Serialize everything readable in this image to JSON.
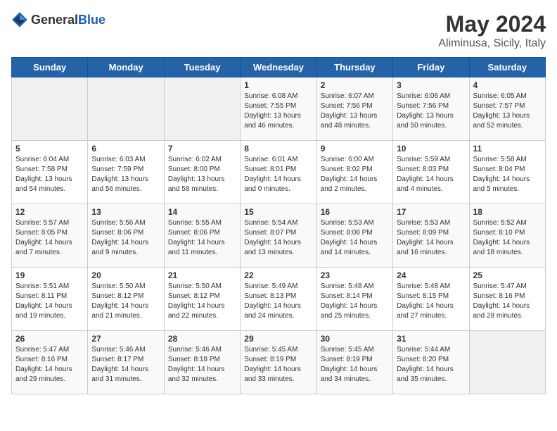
{
  "logo": {
    "text_general": "General",
    "text_blue": "Blue"
  },
  "title": "May 2024",
  "subtitle": "Aliminusa, Sicily, Italy",
  "weekdays": [
    "Sunday",
    "Monday",
    "Tuesday",
    "Wednesday",
    "Thursday",
    "Friday",
    "Saturday"
  ],
  "rows": [
    [
      {
        "day": "",
        "sunrise": "",
        "sunset": "",
        "daylight": "",
        "empty": true
      },
      {
        "day": "",
        "sunrise": "",
        "sunset": "",
        "daylight": "",
        "empty": true
      },
      {
        "day": "",
        "sunrise": "",
        "sunset": "",
        "daylight": "",
        "empty": true
      },
      {
        "day": "1",
        "sunrise": "Sunrise: 6:08 AM",
        "sunset": "Sunset: 7:55 PM",
        "daylight": "Daylight: 13 hours and 46 minutes."
      },
      {
        "day": "2",
        "sunrise": "Sunrise: 6:07 AM",
        "sunset": "Sunset: 7:56 PM",
        "daylight": "Daylight: 13 hours and 48 minutes."
      },
      {
        "day": "3",
        "sunrise": "Sunrise: 6:06 AM",
        "sunset": "Sunset: 7:56 PM",
        "daylight": "Daylight: 13 hours and 50 minutes."
      },
      {
        "day": "4",
        "sunrise": "Sunrise: 6:05 AM",
        "sunset": "Sunset: 7:57 PM",
        "daylight": "Daylight: 13 hours and 52 minutes."
      }
    ],
    [
      {
        "day": "5",
        "sunrise": "Sunrise: 6:04 AM",
        "sunset": "Sunset: 7:58 PM",
        "daylight": "Daylight: 13 hours and 54 minutes."
      },
      {
        "day": "6",
        "sunrise": "Sunrise: 6:03 AM",
        "sunset": "Sunset: 7:59 PM",
        "daylight": "Daylight: 13 hours and 56 minutes."
      },
      {
        "day": "7",
        "sunrise": "Sunrise: 6:02 AM",
        "sunset": "Sunset: 8:00 PM",
        "daylight": "Daylight: 13 hours and 58 minutes."
      },
      {
        "day": "8",
        "sunrise": "Sunrise: 6:01 AM",
        "sunset": "Sunset: 8:01 PM",
        "daylight": "Daylight: 14 hours and 0 minutes."
      },
      {
        "day": "9",
        "sunrise": "Sunrise: 6:00 AM",
        "sunset": "Sunset: 8:02 PM",
        "daylight": "Daylight: 14 hours and 2 minutes."
      },
      {
        "day": "10",
        "sunrise": "Sunrise: 5:59 AM",
        "sunset": "Sunset: 8:03 PM",
        "daylight": "Daylight: 14 hours and 4 minutes."
      },
      {
        "day": "11",
        "sunrise": "Sunrise: 5:58 AM",
        "sunset": "Sunset: 8:04 PM",
        "daylight": "Daylight: 14 hours and 5 minutes."
      }
    ],
    [
      {
        "day": "12",
        "sunrise": "Sunrise: 5:57 AM",
        "sunset": "Sunset: 8:05 PM",
        "daylight": "Daylight: 14 hours and 7 minutes."
      },
      {
        "day": "13",
        "sunrise": "Sunrise: 5:56 AM",
        "sunset": "Sunset: 8:06 PM",
        "daylight": "Daylight: 14 hours and 9 minutes."
      },
      {
        "day": "14",
        "sunrise": "Sunrise: 5:55 AM",
        "sunset": "Sunset: 8:06 PM",
        "daylight": "Daylight: 14 hours and 11 minutes."
      },
      {
        "day": "15",
        "sunrise": "Sunrise: 5:54 AM",
        "sunset": "Sunset: 8:07 PM",
        "daylight": "Daylight: 14 hours and 13 minutes."
      },
      {
        "day": "16",
        "sunrise": "Sunrise: 5:53 AM",
        "sunset": "Sunset: 8:08 PM",
        "daylight": "Daylight: 14 hours and 14 minutes."
      },
      {
        "day": "17",
        "sunrise": "Sunrise: 5:53 AM",
        "sunset": "Sunset: 8:09 PM",
        "daylight": "Daylight: 14 hours and 16 minutes."
      },
      {
        "day": "18",
        "sunrise": "Sunrise: 5:52 AM",
        "sunset": "Sunset: 8:10 PM",
        "daylight": "Daylight: 14 hours and 18 minutes."
      }
    ],
    [
      {
        "day": "19",
        "sunrise": "Sunrise: 5:51 AM",
        "sunset": "Sunset: 8:11 PM",
        "daylight": "Daylight: 14 hours and 19 minutes."
      },
      {
        "day": "20",
        "sunrise": "Sunrise: 5:50 AM",
        "sunset": "Sunset: 8:12 PM",
        "daylight": "Daylight: 14 hours and 21 minutes."
      },
      {
        "day": "21",
        "sunrise": "Sunrise: 5:50 AM",
        "sunset": "Sunset: 8:12 PM",
        "daylight": "Daylight: 14 hours and 22 minutes."
      },
      {
        "day": "22",
        "sunrise": "Sunrise: 5:49 AM",
        "sunset": "Sunset: 8:13 PM",
        "daylight": "Daylight: 14 hours and 24 minutes."
      },
      {
        "day": "23",
        "sunrise": "Sunrise: 5:48 AM",
        "sunset": "Sunset: 8:14 PM",
        "daylight": "Daylight: 14 hours and 25 minutes."
      },
      {
        "day": "24",
        "sunrise": "Sunrise: 5:48 AM",
        "sunset": "Sunset: 8:15 PM",
        "daylight": "Daylight: 14 hours and 27 minutes."
      },
      {
        "day": "25",
        "sunrise": "Sunrise: 5:47 AM",
        "sunset": "Sunset: 8:16 PM",
        "daylight": "Daylight: 14 hours and 28 minutes."
      }
    ],
    [
      {
        "day": "26",
        "sunrise": "Sunrise: 5:47 AM",
        "sunset": "Sunset: 8:16 PM",
        "daylight": "Daylight: 14 hours and 29 minutes."
      },
      {
        "day": "27",
        "sunrise": "Sunrise: 5:46 AM",
        "sunset": "Sunset: 8:17 PM",
        "daylight": "Daylight: 14 hours and 31 minutes."
      },
      {
        "day": "28",
        "sunrise": "Sunrise: 5:46 AM",
        "sunset": "Sunset: 8:18 PM",
        "daylight": "Daylight: 14 hours and 32 minutes."
      },
      {
        "day": "29",
        "sunrise": "Sunrise: 5:45 AM",
        "sunset": "Sunset: 8:19 PM",
        "daylight": "Daylight: 14 hours and 33 minutes."
      },
      {
        "day": "30",
        "sunrise": "Sunrise: 5:45 AM",
        "sunset": "Sunset: 8:19 PM",
        "daylight": "Daylight: 14 hours and 34 minutes."
      },
      {
        "day": "31",
        "sunrise": "Sunrise: 5:44 AM",
        "sunset": "Sunset: 8:20 PM",
        "daylight": "Daylight: 14 hours and 35 minutes."
      },
      {
        "day": "",
        "sunrise": "",
        "sunset": "",
        "daylight": "",
        "empty": true
      }
    ]
  ]
}
